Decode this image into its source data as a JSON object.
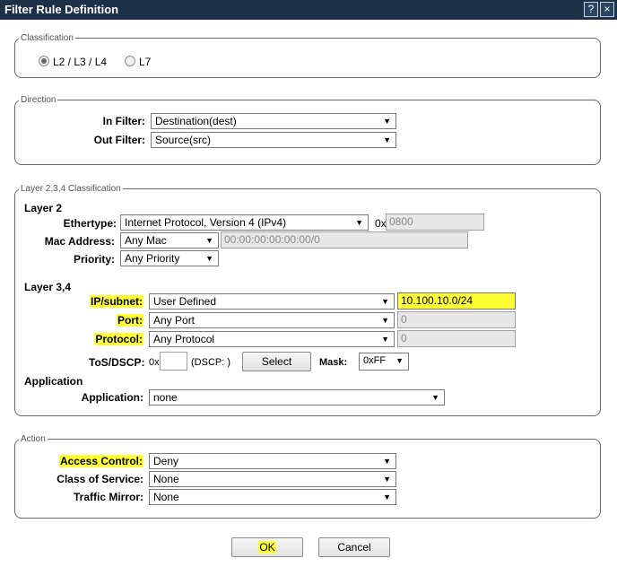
{
  "dialog": {
    "title": "Filter Rule Definition",
    "help_glyph": "?",
    "close_glyph": "×"
  },
  "classification": {
    "legend": "Classification",
    "options": [
      "L2 / L3 / L4",
      "L7"
    ],
    "selected": "L2 / L3 / L4"
  },
  "direction": {
    "legend": "Direction",
    "in_filter_label": "In Filter:",
    "in_filter_value": "Destination(dest)",
    "out_filter_label": "Out Filter:",
    "out_filter_value": "Source(src)"
  },
  "layer": {
    "legend": "Layer 2,3,4 Classification",
    "layer2_heading": "Layer 2",
    "ethertype_label": "Ethertype:",
    "ethertype_value": "Internet Protocol, Version 4 (IPv4)",
    "ethertype_prefix": "0x",
    "ethertype_hex": "0800",
    "mac_label": "Mac Address:",
    "mac_value": "Any Mac",
    "mac_field": "00:00:00:00:00:00/0",
    "priority_label": "Priority:",
    "priority_value": "Any Priority",
    "layer34_heading": "Layer 3,4",
    "ip_label": "IP/subnet:",
    "ip_value": "User Defined",
    "ip_field": "10.100.10.0/24",
    "port_label": "Port:",
    "port_value": "Any Port",
    "port_field": "0",
    "protocol_label": "Protocol:",
    "protocol_value": "Any Protocol",
    "protocol_field": "0",
    "tos_label": "ToS/DSCP:",
    "tos_prefix": "0x",
    "tos_value": "",
    "dscp_text": "(DSCP: )",
    "select_button": "Select",
    "mask_label": "Mask:",
    "mask_value": "0xFF",
    "application_heading": "Application",
    "application_label": "Application:",
    "application_value": "none"
  },
  "action": {
    "legend": "Action",
    "access_label": "Access Control:",
    "access_value": "Deny",
    "cos_label": "Class of Service:",
    "cos_value": "None",
    "mirror_label": "Traffic Mirror:",
    "mirror_value": "None"
  },
  "buttons": {
    "ok": "OK",
    "cancel": "Cancel"
  },
  "colors": {
    "titlebar": "#1c3048",
    "highlight": "#ffff33"
  }
}
